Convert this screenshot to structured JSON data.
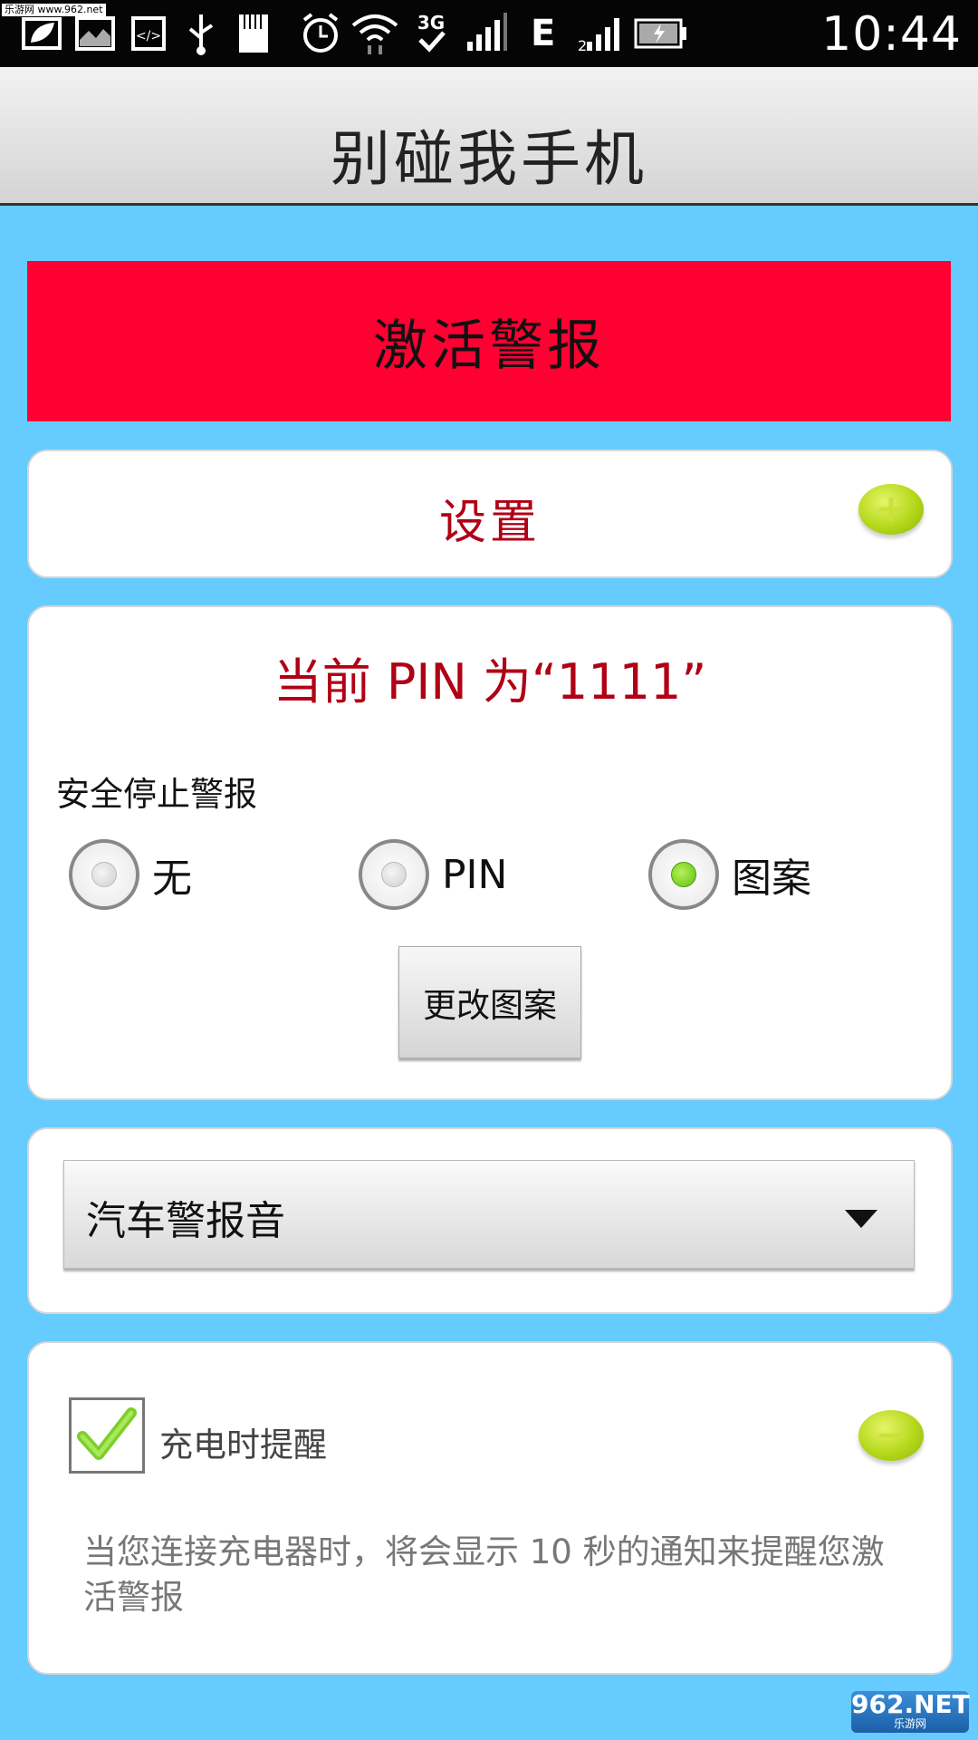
{
  "status_bar": {
    "time": "10:44",
    "network": "3G",
    "edge": "E",
    "watermark_text": "乐游网 www.962.net",
    "icons": [
      "leaf-icon",
      "image-icon",
      "code-icon",
      "usb-icon",
      "sd-card-icon",
      "alarm-icon",
      "wifi-icon",
      "3g-icon",
      "signal-icon",
      "signal-icon",
      "battery-charging-icon"
    ]
  },
  "header": {
    "title": "别碰我手机"
  },
  "activate_button": {
    "label": "激活警报",
    "color": "#ff0033"
  },
  "settings_card": {
    "label": "设置",
    "toggle_symbol": "+"
  },
  "pin_card": {
    "title": "当前 PIN 为“1111”",
    "security_label": "安全停止警报",
    "options": [
      {
        "label": "无",
        "checked": false
      },
      {
        "label": "PIN",
        "checked": false
      },
      {
        "label": "图案",
        "checked": true
      }
    ],
    "change_button": "更改图案"
  },
  "sound_card": {
    "selected": "汽车警报音"
  },
  "charge_card": {
    "checkbox_checked": true,
    "label": "充电时提醒",
    "toggle_symbol": "−",
    "description": "当您连接充电器时，将会显示 10 秒的通知来提醒您激活警报"
  },
  "corner_watermark": {
    "main": "962.NET",
    "sub": "乐游网"
  }
}
